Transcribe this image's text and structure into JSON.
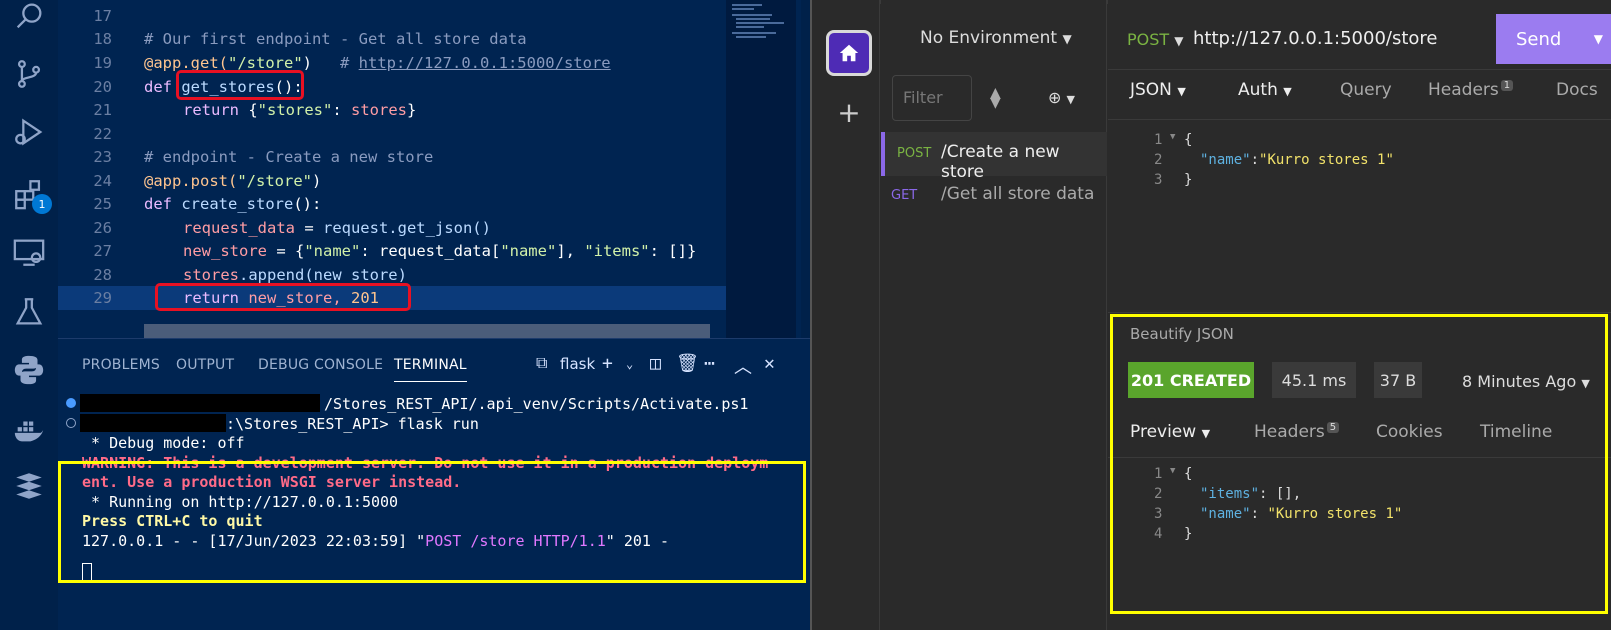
{
  "activity_bar": {
    "items": [
      {
        "icon": "search-icon"
      },
      {
        "icon": "source-control-icon"
      },
      {
        "icon": "run-debug-icon"
      },
      {
        "icon": "extensions-icon",
        "badge": "1"
      },
      {
        "icon": "remote-explorer-icon"
      },
      {
        "icon": "testing-flask-icon"
      },
      {
        "icon": "python-icon"
      },
      {
        "icon": "docker-icon"
      },
      {
        "icon": "stack-icon"
      }
    ]
  },
  "editor": {
    "lines": [
      {
        "n": "17"
      },
      {
        "n": "18",
        "comment": "# Our first endpoint - Get all store data"
      },
      {
        "n": "19",
        "decorator": "@app.get(",
        "str": "\"/store\"",
        "close": ")",
        "comment": "# ",
        "url": "http://127.0.0.1:5000/store"
      },
      {
        "n": "20",
        "kw": "def ",
        "fn": "get_stores",
        "rest": "():"
      },
      {
        "n": "21",
        "kw": "return ",
        "open": "{",
        "str": "\"stores\"",
        "colon": ": ",
        "var": "stores",
        "close": "}"
      },
      {
        "n": "22"
      },
      {
        "n": "23",
        "comment": "# endpoint - Create a new store"
      },
      {
        "n": "24",
        "decorator": "@app.post(",
        "str": "\"/store\"",
        "close": ")"
      },
      {
        "n": "25",
        "kw": "def ",
        "fn": "create_store",
        "rest": "():"
      },
      {
        "n": "26",
        "var": "request_data",
        "eq": " = ",
        "call": "request.get_json()"
      },
      {
        "n": "27",
        "var": "new_store",
        "eq": " = {",
        "str1": "\"name\"",
        "mid": ": request_data[",
        "str2": "\"name\"",
        "mid2": "], ",
        "str3": "\"items\"",
        "end": ": []}"
      },
      {
        "n": "28",
        "var": "stores",
        "call": ".append(new_store)"
      },
      {
        "n": "29",
        "kw": "return ",
        "rest": "new_store, ",
        "num": "201"
      }
    ]
  },
  "panel": {
    "tabs": [
      "PROBLEMS",
      "OUTPUT",
      "DEBUG CONSOLE",
      "TERMINAL"
    ],
    "terminal_name": "flask",
    "terminal": {
      "line1": "/Stores_REST_API/.api_venv/Scripts/Activate.ps1",
      "line2": ":\\Stores_REST_API> flask run",
      "line3": " * Debug mode: off",
      "warn1": "WARNING: This is a development server. Do not use it in a production deploym",
      "warn2": "ent. Use a production WSGI server instead.",
      "line6": " * Running on http://127.0.0.1:5000",
      "line7": "Press CTRL+C to quit",
      "log_prefix": "127.0.0.1 - - [17/Jun/2023 22:03:59] \"",
      "log_request": "POST /store HTTP/1.1",
      "log_suffix": "\" 201 -"
    }
  },
  "insomnia": {
    "environment": "No Environment",
    "filter_placeholder": "Filter",
    "requests": [
      {
        "method": "POST",
        "name": "/Create a new store",
        "color": "#7ab342"
      },
      {
        "method": "GET",
        "name": "/Get all store data",
        "color": "#8b68e8"
      }
    ],
    "request": {
      "method": "POST",
      "url": "http://127.0.0.1:5000/store",
      "send_label": "Send",
      "tabs": {
        "body": "JSON",
        "auth": "Auth",
        "query": "Query",
        "headers": "Headers",
        "headers_count": "1",
        "docs": "Docs"
      },
      "body_lines": [
        {
          "n": "1",
          "text": "{"
        },
        {
          "n": "2",
          "key": "\"name\"",
          "sep": ":",
          "val": "\"Kurro stores 1\""
        },
        {
          "n": "3",
          "text": "}"
        }
      ]
    },
    "response": {
      "beautify": "Beautify JSON",
      "status": "201 CREATED",
      "time": "45.1 ms",
      "size": "37 B",
      "ago": "8 Minutes Ago",
      "tabs": {
        "preview": "Preview",
        "headers": "Headers",
        "headers_count": "5",
        "cookies": "Cookies",
        "timeline": "Timeline"
      },
      "body_lines": [
        {
          "n": "1",
          "text": "{"
        },
        {
          "n": "2",
          "key": "\"items\"",
          "sep": ": ",
          "val": "[],"
        },
        {
          "n": "3",
          "key": "\"name\"",
          "sep": ": ",
          "val": "\"Kurro stores 1\""
        },
        {
          "n": "4",
          "text": "}"
        }
      ]
    }
  }
}
